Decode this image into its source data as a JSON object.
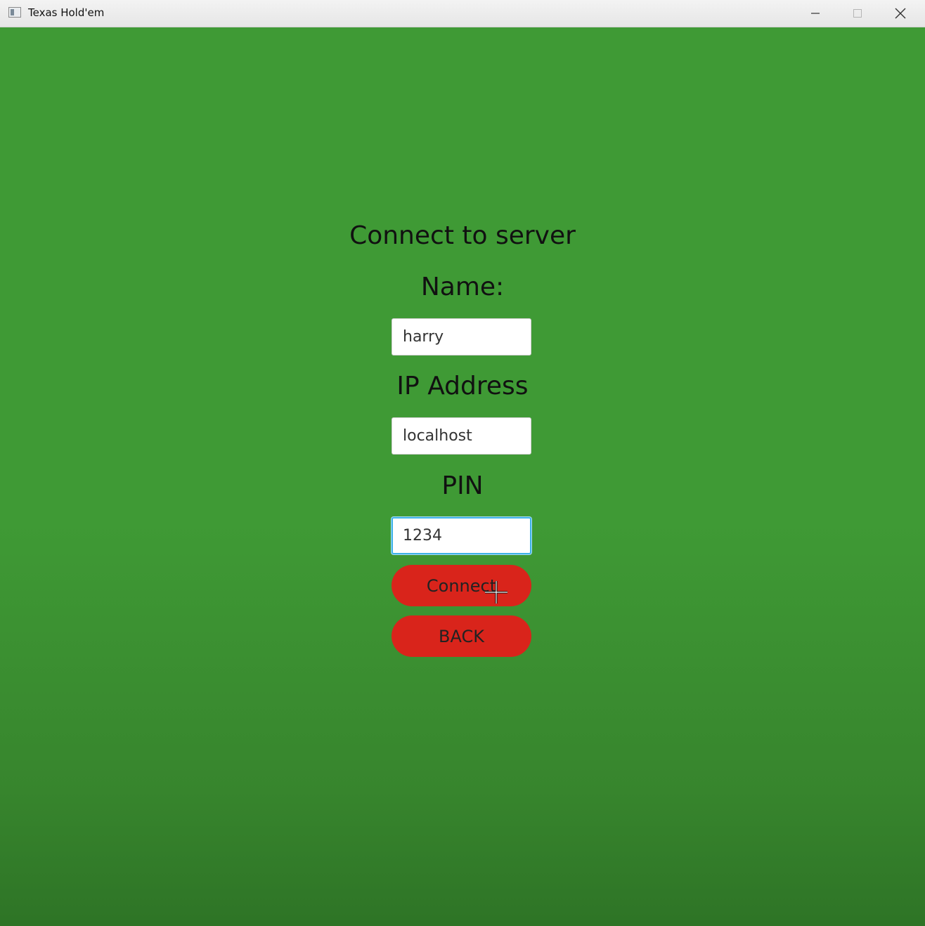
{
  "window": {
    "title": "Texas Hold'em",
    "controls": [
      "minimize",
      "maximize",
      "close"
    ]
  },
  "form": {
    "title": "Connect to server",
    "name_label": "Name:",
    "name_value": "harry",
    "ip_label": "IP Address",
    "ip_value": "localhost",
    "pin_label": "PIN",
    "pin_value": "1234",
    "focused_field": "pin"
  },
  "buttons": {
    "connect_label": "Connect",
    "back_label": "BACK"
  },
  "colors": {
    "background": "#3f9a35",
    "button": "#d9241b",
    "focus_ring": "#3fb2e8"
  }
}
